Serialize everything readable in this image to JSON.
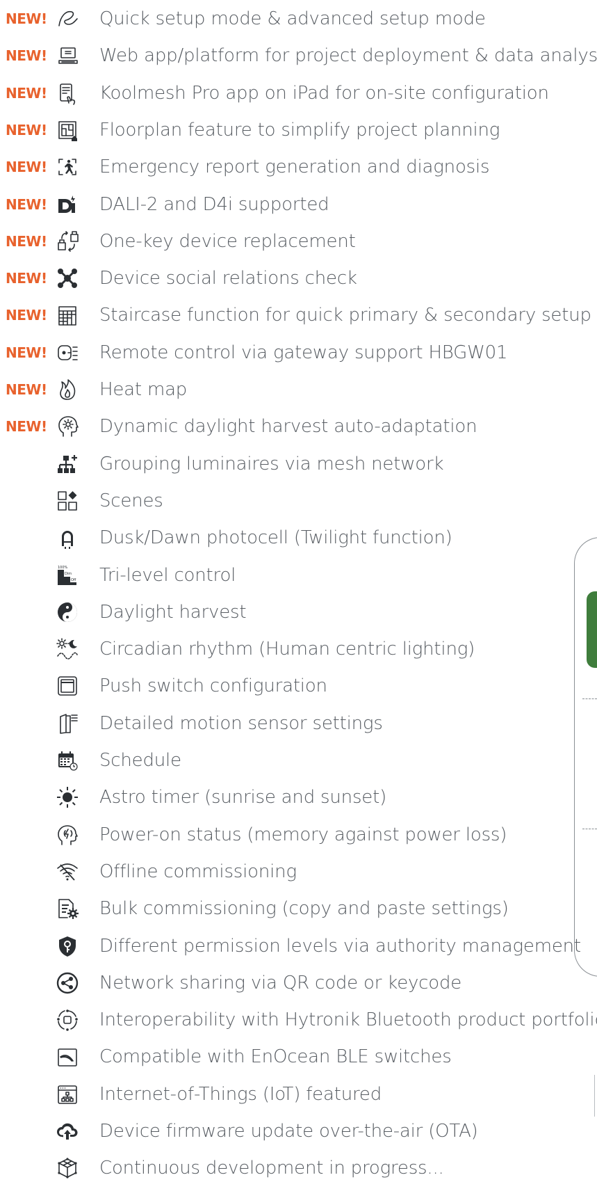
{
  "new_badge": "NEW!",
  "colors": {
    "badge": "#e8622d",
    "text": "#585d63",
    "icon": "#2b2f33",
    "accent_green": "#3f7d3c"
  },
  "features": [
    {
      "label": "Quick setup mode & advanced setup mode",
      "icon": "gesture-signature-icon",
      "new": true
    },
    {
      "label": "Web app/platform for project deployment & data analysis",
      "icon": "laptop-icon",
      "new": true
    },
    {
      "label": "Koolmesh Pro app on iPad for on-site configuration",
      "icon": "tablet-touch-icon",
      "new": true
    },
    {
      "label": "Floorplan feature to simplify project planning",
      "icon": "floorplan-icon",
      "new": true
    },
    {
      "label": "Emergency report generation and diagnosis",
      "icon": "emergency-exit-icon",
      "new": true
    },
    {
      "label": "DALI-2 and D4i supported",
      "icon": "dali-logo-icon",
      "new": true
    },
    {
      "label": "One-key device replacement",
      "icon": "device-swap-icon",
      "new": true
    },
    {
      "label": "Device social relations check",
      "icon": "network-nodes-icon",
      "new": true
    },
    {
      "label": "Staircase function for quick primary & secondary setup",
      "icon": "staircase-icon",
      "new": true
    },
    {
      "label": "Remote control via gateway support HBGW01",
      "icon": "gateway-icon",
      "new": true
    },
    {
      "label": "Heat map",
      "icon": "flame-icon",
      "new": true
    },
    {
      "label": "Dynamic daylight harvest auto-adaptation",
      "icon": "head-sun-icon",
      "new": true
    },
    {
      "label": "Grouping luminaires via mesh network",
      "icon": "hierarchy-plus-icon",
      "new": false
    },
    {
      "label": "Scenes",
      "icon": "scenes-grid-icon",
      "new": false
    },
    {
      "label": "Dusk/Dawn photocell (Twilight function)",
      "icon": "photocell-icon",
      "new": false
    },
    {
      "label": "Tri-level control",
      "icon": "tri-level-icon",
      "new": false,
      "icon_text": [
        "100%",
        "Dim",
        "Off"
      ]
    },
    {
      "label": "Daylight harvest",
      "icon": "yin-yang-icon",
      "new": false
    },
    {
      "label": "Circadian rhythm (Human centric lighting)",
      "icon": "sun-moon-wave-icon",
      "new": false
    },
    {
      "label": "Push switch configuration",
      "icon": "push-switch-icon",
      "new": false
    },
    {
      "label": "Detailed motion sensor settings",
      "icon": "door-sensor-icon",
      "new": false
    },
    {
      "label": "Schedule",
      "icon": "calendar-icon",
      "new": false
    },
    {
      "label": "Astro timer (sunrise and sunset)",
      "icon": "sun-icon",
      "new": false
    },
    {
      "label": "Power-on status (memory against power loss)",
      "icon": "power-memory-icon",
      "new": false
    },
    {
      "label": "Offline commissioning",
      "icon": "wifi-off-icon",
      "new": false
    },
    {
      "label": "Bulk commissioning (copy and paste settings)",
      "icon": "settings-list-icon",
      "new": false
    },
    {
      "label": "Different permission levels via authority management",
      "icon": "shield-key-icon",
      "new": false
    },
    {
      "label": "Network sharing via QR code or keycode",
      "icon": "share-icon",
      "new": false
    },
    {
      "label": "Interoperability with Hytronik Bluetooth product portfolio",
      "icon": "interop-cycle-icon",
      "new": false
    },
    {
      "label": "Compatible with EnOcean BLE switches",
      "icon": "enocean-switch-icon",
      "new": false
    },
    {
      "label": "Internet-of-Things (IoT) featured",
      "icon": "iot-window-icon",
      "new": false
    },
    {
      "label": "Device firmware update over-the-air (OTA)",
      "icon": "cloud-upload-icon",
      "new": false
    },
    {
      "label": "Continuous development in progress...",
      "icon": "cube-network-icon",
      "new": false
    }
  ]
}
